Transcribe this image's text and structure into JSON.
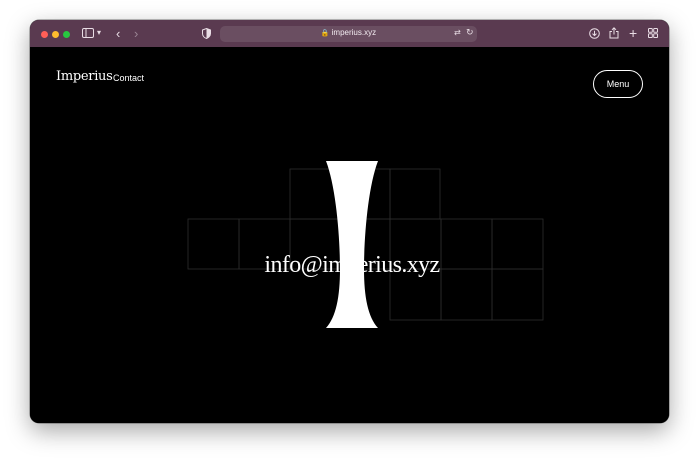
{
  "browser": {
    "url": "imperius.xyz",
    "icons": {
      "sidebar": "sidebar-icon",
      "back": "chevron-left-icon",
      "forward": "chevron-right-icon",
      "shield": "shield-icon",
      "lock": "lock-icon",
      "translate": "translate-icon",
      "reload": "reload-icon",
      "download": "download-icon",
      "share": "share-icon",
      "new_tab": "plus-icon",
      "tabs": "tab-overview-icon"
    }
  },
  "site": {
    "logo": "Imperius",
    "nav_contact": "Contact",
    "menu_label": "Menu",
    "email": "info@imperius.xyz"
  },
  "colors": {
    "toolbar": "#5a3a50",
    "page_background": "#000000",
    "text": "#ffffff",
    "grid_line": "#2a2a2a"
  }
}
